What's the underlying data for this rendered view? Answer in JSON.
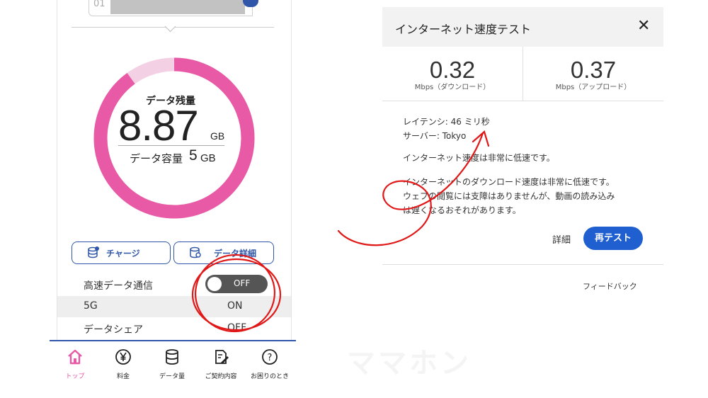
{
  "phone": {
    "masked_prefix": "01",
    "ring": {
      "label": "データ残量",
      "remaining_value": "8.87",
      "remaining_unit": "GB",
      "capacity_label": "データ容量",
      "capacity_value": "5",
      "capacity_unit": "GB",
      "color": "#e85aa6",
      "remaining_fraction": 0.9
    },
    "buttons": {
      "charge": "チャージ",
      "detail": "データ詳細"
    },
    "settings": [
      {
        "label": "高速データ通信",
        "value": "OFF"
      },
      {
        "label": "5G",
        "value": "ON"
      },
      {
        "label": "データシェア",
        "value": "OFF"
      }
    ],
    "tabs": [
      {
        "label": "トップ",
        "icon": "home-icon",
        "active": true
      },
      {
        "label": "料金",
        "icon": "yen-icon"
      },
      {
        "label": "データ量",
        "icon": "database-icon"
      },
      {
        "label": "ご契約内容",
        "icon": "contract-icon"
      },
      {
        "label": "お困りのとき",
        "icon": "help-icon"
      }
    ],
    "accent": "#2f56a8",
    "active_tab_color": "#e85aa6"
  },
  "dialog": {
    "title": "インターネット速度テスト",
    "close": "✕",
    "download": {
      "value": "0.32",
      "unit": "Mbps（ダウンロード）"
    },
    "upload": {
      "value": "0.37",
      "unit": "Mbps（アップロード）"
    },
    "latency": "レイテンシ: 46 ミリ秒",
    "server": "サーバー: Tokyo",
    "summary": "インターネット速度は非常に低速です。",
    "details": [
      "インターネットのダウンロード速度は非常に低速です。",
      "ウェブの閲覧には支障はありませんが、動画の読み込み",
      "は遅くなるおそれがあります。"
    ],
    "detail_link": "詳細",
    "retest": "再テスト",
    "feedback": "フィードバック",
    "accent": "#1f5fd0"
  },
  "watermark": "ママホン",
  "annotation_color": "#e01818"
}
